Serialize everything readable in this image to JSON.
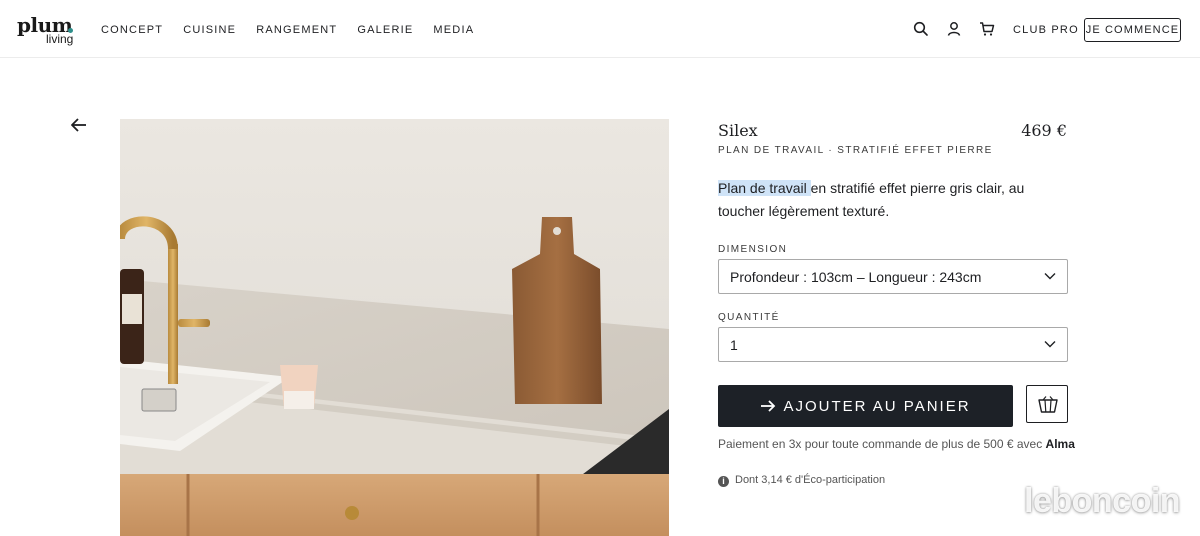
{
  "brand": {
    "line1": "plum",
    "line2": "living"
  },
  "nav": {
    "items": [
      "CONCEPT",
      "CUISINE",
      "RANGEMENT",
      "GALERIE",
      "MEDIA"
    ],
    "club_pro": "CLUB PRO",
    "cta": "JE COMMENCE"
  },
  "icons": {
    "search": "search-icon",
    "account": "user-icon",
    "cart": "cart-icon",
    "back": "arrow-left-icon",
    "basket": "basket-icon",
    "info": "info-icon"
  },
  "product": {
    "name": "Silex",
    "price": "469 €",
    "subtitle": "PLAN DE TRAVAIL · STRATIFIÉ EFFET PIERRE",
    "description_highlight": "Plan de travail ",
    "description_rest": "en stratifié effet pierre gris clair, au toucher légèrement texturé."
  },
  "options": {
    "dimension_label": "DIMENSION",
    "dimension_value": "Profondeur : 103cm – Longueur : 243cm",
    "quantity_label": "QUANTITÉ",
    "quantity_value": "1"
  },
  "actions": {
    "add_to_cart": "AJOUTER AU PANIER"
  },
  "payment": {
    "text": "Paiement en 3x pour toute commande de plus de 500 € avec ",
    "provider": "Alma"
  },
  "eco": {
    "text": "Dont 3,14 € d'Éco-participation"
  },
  "watermark": "leboncoin",
  "colors": {
    "button_dark": "#1d2127",
    "highlight": "#cfe3f7",
    "logo_dot": "#2f8f8b"
  }
}
